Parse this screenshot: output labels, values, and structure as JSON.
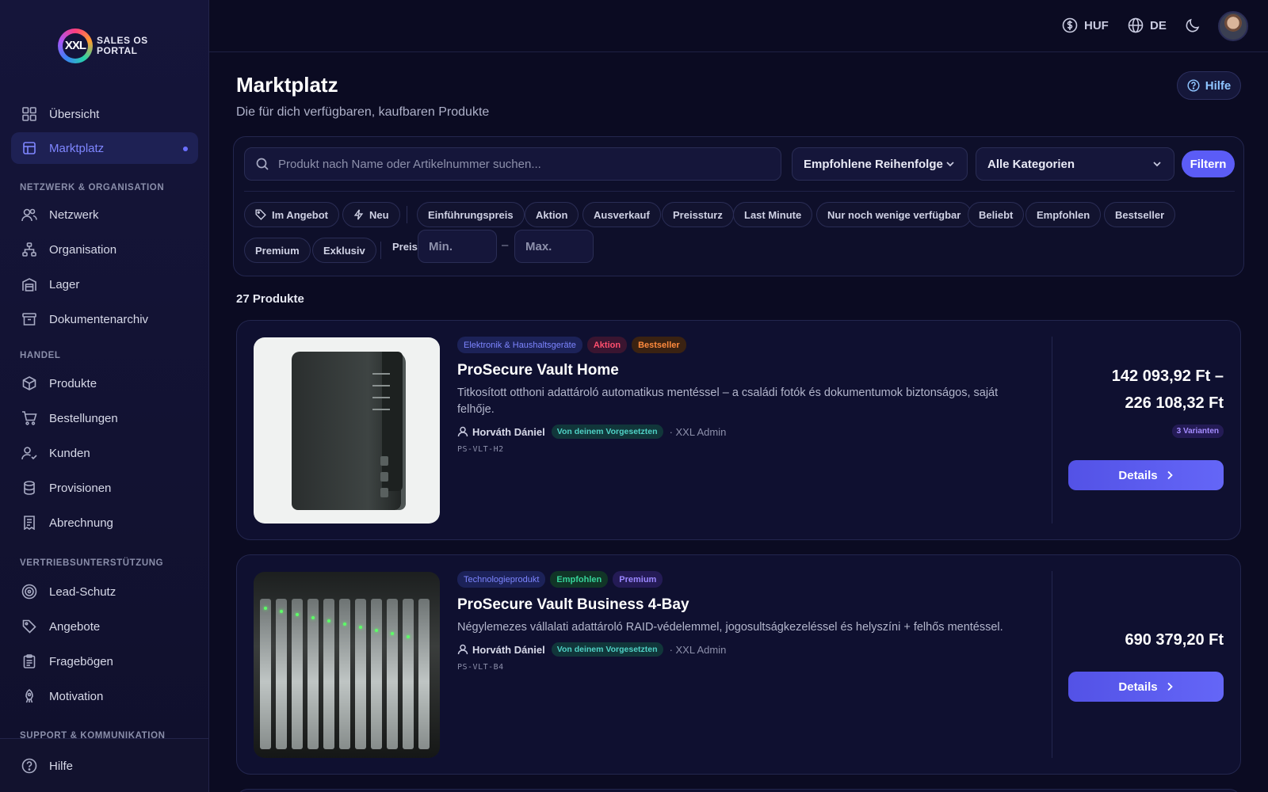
{
  "brand": {
    "logo_mark": "XXL",
    "logo_text": "SALES OS PORTAL"
  },
  "sidebar": {
    "items_top": [
      {
        "label": "Übersicht",
        "icon": "grid-icon"
      },
      {
        "label": "Marktplatz",
        "icon": "store-icon",
        "active": true
      }
    ],
    "sections": [
      {
        "label": "NETZWERK & ORGANISATION",
        "items": [
          {
            "label": "Netzwerk",
            "icon": "users-icon"
          },
          {
            "label": "Organisation",
            "icon": "org-chart-icon"
          },
          {
            "label": "Lager",
            "icon": "warehouse-icon"
          },
          {
            "label": "Dokumentenarchiv",
            "icon": "archive-icon"
          }
        ]
      },
      {
        "label": "HANDEL",
        "items": [
          {
            "label": "Produkte",
            "icon": "package-icon"
          },
          {
            "label": "Bestellungen",
            "icon": "cart-icon"
          },
          {
            "label": "Kunden",
            "icon": "user-check-icon"
          },
          {
            "label": "Provisionen",
            "icon": "coins-icon"
          },
          {
            "label": "Abrechnung",
            "icon": "receipt-icon"
          }
        ]
      },
      {
        "label": "VERTRIEBSUNTERSTÜTZUNG",
        "items": [
          {
            "label": "Lead-Schutz",
            "icon": "target-icon"
          },
          {
            "label": "Angebote",
            "icon": "tag-icon"
          },
          {
            "label": "Fragebögen",
            "icon": "clipboard-icon"
          },
          {
            "label": "Motivation",
            "icon": "rocket-icon"
          }
        ]
      },
      {
        "label": "SUPPORT & KOMMUNIKATION",
        "items": []
      }
    ],
    "bottom_item": {
      "label": "Hilfe",
      "icon": "help-circle-icon"
    }
  },
  "topbar": {
    "currency": "HUF",
    "language": "DE",
    "theme_icon": "moon-icon"
  },
  "page": {
    "title": "Marktplatz",
    "subtitle": "Die für dich verfügbaren, kaufbaren Produkte",
    "help_label": "Hilfe"
  },
  "filters": {
    "search_placeholder": "Produkt nach Name oder Artikelnummer suchen...",
    "sort_value": "Empfohlene Reihenfolge",
    "category_value": "Alle Kategorien",
    "filter_button": "Filtern",
    "chips": [
      "Im Angebot",
      "Neu",
      "Einführungspreis",
      "Aktion",
      "Ausverkauf",
      "Preissturz",
      "Last Minute",
      "Nur noch wenige verfügbar",
      "Beliebt",
      "Empfohlen",
      "Bestseller",
      "Premium",
      "Exklusiv"
    ],
    "price_label": "Preis",
    "price_min_placeholder": "Min.",
    "price_max_placeholder": "Max.",
    "price_dash": "–"
  },
  "results_count": "27 Produkte",
  "products": [
    {
      "tags": [
        "Elektronik & Haushaltsgeräte",
        "Aktion",
        "Bestseller"
      ],
      "name": "ProSecure Vault Home",
      "description": "Titkosított otthoni adattároló automatikus mentéssel – a családi fotók és dokumentumok biztonságos, saját felhője.",
      "seller": "Horváth Dániel",
      "seller_badge": "Von deinem Vorgesetzten",
      "seller_org": "· XXL Admin",
      "sku": "PS-VLT-H2",
      "price_line1": "142 093,92 Ft –",
      "price_line2": "226 108,32 Ft",
      "variants": "3 Varianten",
      "details_label": "Details"
    },
    {
      "tags": [
        "Technologieprodukt",
        "Empfohlen",
        "Premium"
      ],
      "name": "ProSecure Vault Business 4-Bay",
      "description": "Négylemezes vállalati adattároló RAID-védelemmel, jogosultságkezeléssel és helyszíni + felhős mentéssel.",
      "seller": "Horváth Dániel",
      "seller_badge": "Von deinem Vorgesetzten",
      "seller_org": "· XXL Admin",
      "sku": "PS-VLT-B4",
      "price": "690 379,20 Ft",
      "details_label": "Details"
    }
  ]
}
